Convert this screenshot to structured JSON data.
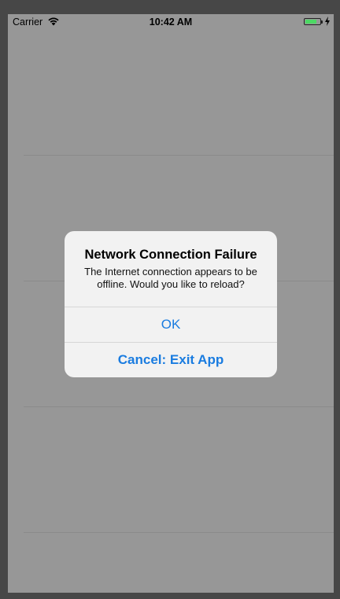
{
  "status_bar": {
    "carrier": "Carrier",
    "time": "10:42 AM",
    "battery_level": 0.75,
    "battery_color": "#4cd964",
    "charging": true
  },
  "alert": {
    "title": "Network Connection Failure",
    "message": "The Internet connection appears to be offline. Would you like to reload?",
    "buttons": [
      {
        "label": "OK",
        "style": "default",
        "color": "#1a7ce0"
      },
      {
        "label": "Cancel: Exit App",
        "style": "bold",
        "color": "#1a7ce0"
      }
    ]
  },
  "icons": [
    "wifi-icon",
    "battery-icon",
    "charging-bolt-icon"
  ]
}
